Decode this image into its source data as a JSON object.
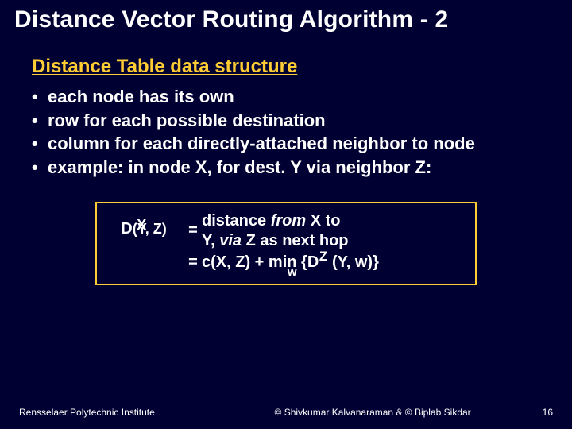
{
  "title": "Distance Vector Routing Algorithm - 2",
  "subtitle": "Distance Table data structure",
  "bullets": [
    "each node has its own",
    "row for each possible destination",
    "column for each directly-attached neighbor to node",
    "example: in node X, for dest. Y via neighbor Z:"
  ],
  "formula": {
    "lhs_base": "D",
    "lhs_super": "X",
    "lhs_args": "(Y, Z)",
    "line1_pre": "distance ",
    "line1_italic": "from",
    "line1_post": " X to",
    "line2_pre": "Y, ",
    "line2_italic": "via",
    "line2_post": " Z as next hop",
    "line3_pre": "c(X, Z) + ",
    "line3_min": "min",
    "line3_min_sub": "w",
    "line3_brace_open": "{",
    "line3_D": "D",
    "line3_D_sup": "Z",
    "line3_Dargs": " (Y, w)}",
    "eq": "="
  },
  "footer": {
    "left": "Rensselaer Polytechnic Institute",
    "mid": "© Shivkumar Kalvanaraman   &   © Biplab Sikdar",
    "page": "16"
  }
}
